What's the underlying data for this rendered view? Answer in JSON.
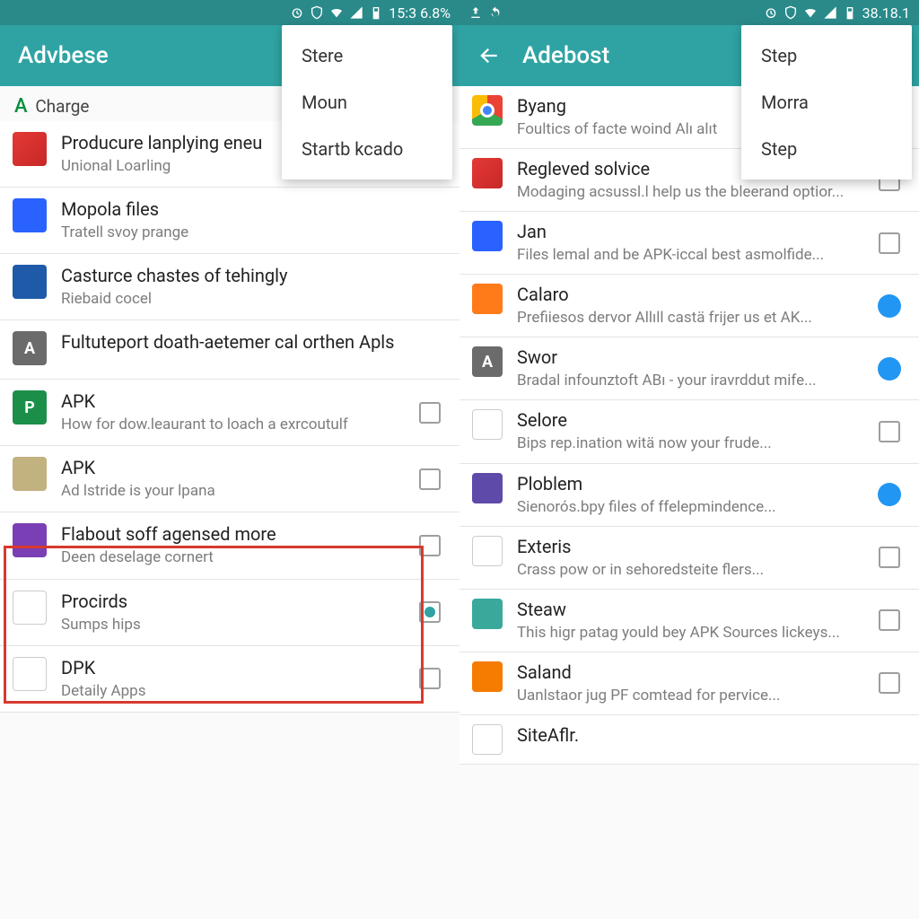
{
  "left": {
    "statusbar": {
      "time": "15:3 6.8%"
    },
    "appbar": {
      "title": "Advbese"
    },
    "section": {
      "lead": "A",
      "label": "Charge"
    },
    "menu": [
      "Stere",
      "Moun",
      "Startb kcado"
    ],
    "items": [
      {
        "icon": "ic-gmail",
        "title": "Producure lanplying eneu",
        "sub": "Unional Loarling",
        "ctrl": "none"
      },
      {
        "icon": "ic-docs",
        "title": "Mopola files",
        "sub": "Tratell svoy prange",
        "ctrl": "none"
      },
      {
        "icon": "ic-word",
        "title": "Casturce chastes of tehingly",
        "sub": "Riebaid cocel",
        "ctrl": "none"
      },
      {
        "icon": "ic-gray",
        "glyph": "A",
        "title": "Fultuteport doath-aetemer cal orthen Apls",
        "sub": "",
        "ctrl": "none"
      },
      {
        "icon": "ic-green",
        "glyph": "P",
        "title": "APK",
        "sub": "How for dow.leaurant to loach a exrcoutulf",
        "ctrl": "checkbox"
      },
      {
        "icon": "ic-circle1",
        "title": "APK",
        "sub": "Ad lstride is your lpana",
        "ctrl": "checkbox"
      },
      {
        "icon": "ic-purple",
        "title": "Flabout soff agensed more",
        "sub": "Deen deselage cornert",
        "ctrl": "checkbox"
      },
      {
        "icon": "ic-sheets",
        "title": "Procirds",
        "sub": "Sumps hips",
        "ctrl": "checkbox-dotted"
      },
      {
        "icon": "ic-bar",
        "title": "DPK",
        "sub": "Detaily Apps",
        "ctrl": "checkbox"
      }
    ]
  },
  "right": {
    "statusbar": {
      "time": "38.18.1"
    },
    "appbar": {
      "title": "Adebost"
    },
    "menu": [
      "Step",
      "Morra",
      "Step"
    ],
    "items": [
      {
        "icon": "ic-chrome",
        "title": "Byang",
        "sub": "Foultics of facte woind Alı alıt",
        "ctrl": "none"
      },
      {
        "icon": "ic-gmail",
        "title": "Regleved solvice",
        "sub": "Modaging acsussl.l help us the bleerand optior...",
        "ctrl": "checkbox"
      },
      {
        "icon": "ic-bluebook",
        "title": "Jan",
        "sub": "Files lemal and be APK-iccal best asmolfide...",
        "ctrl": "checkbox"
      },
      {
        "icon": "ic-orangebag",
        "title": "Calaro",
        "sub": "Prefiiesos dervor Allıll castä frijer us et AK...",
        "ctrl": "toggle-on"
      },
      {
        "icon": "ic-gray",
        "glyph": "A",
        "title": "Swor",
        "sub": "Bradal infounztoft ABı - your iravrddut mife...",
        "ctrl": "toggle-on"
      },
      {
        "icon": "ic-paper",
        "title": "Selore",
        "sub": "Bips rep.ination witä now your frude...",
        "ctrl": "checkbox"
      },
      {
        "icon": "ic-purplebook",
        "title": "Ploblem",
        "sub": "Sienorós.bpy files of ffelepmindence...",
        "ctrl": "toggle-on"
      },
      {
        "icon": "ic-paper",
        "title": "Exteris",
        "sub": "Crass pow or in sehoredsteite flers...",
        "ctrl": "checkbox"
      },
      {
        "icon": "ic-tealcard",
        "title": "Steaw",
        "sub": "This higr patag yould bey APK Sources lickeys...",
        "ctrl": "checkbox"
      },
      {
        "icon": "ic-orangebook",
        "title": "Saland",
        "sub": "Uanlstaor jug PF comtead for pervice...",
        "ctrl": "checkbox"
      },
      {
        "icon": "ic-bluefile",
        "title": "SiteAflr.",
        "sub": "",
        "ctrl": "none"
      }
    ]
  }
}
